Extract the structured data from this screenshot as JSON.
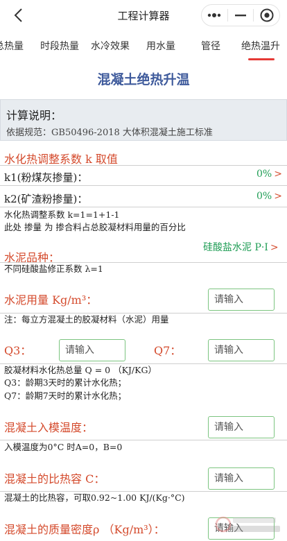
{
  "navbar": {
    "title": "工程计算器",
    "back_icon": "chevron-left-icon",
    "more_icon": "more-dots-icon",
    "minimize_icon": "minimize-icon",
    "close_icon": "target-circle-icon"
  },
  "tabs": [
    {
      "label": "总热量"
    },
    {
      "label": "时段热量"
    },
    {
      "label": "水冷效果"
    },
    {
      "label": "用水量"
    },
    {
      "label": "管径"
    },
    {
      "label": "绝热温升",
      "active": true
    }
  ],
  "page_title": "混凝土绝热升温",
  "explain": {
    "heading": "计算说明：",
    "reference": "依据规范：GB50496-2018 大体积混凝土施工标准"
  },
  "k_section": {
    "heading": "水化热调整系数 k 取值",
    "k1_label": "k1(粉煤灰掺量)：",
    "k1_value": "0%",
    "k2_label": "k2(矿渣粉掺量)：",
    "k2_value": "0%",
    "note1": "水化热调整系数 k=1=1+1-1",
    "note2": "此处 掺量 为 掺合料占总胶凝材料用量的百分比"
  },
  "cement_type": {
    "label": "水泥品种：",
    "value": "硅酸盐水泥 P·I",
    "note": "不同硅酸盐修正系数 λ=1"
  },
  "cement_amount": {
    "label": "水泥用量 Kg/m³：",
    "placeholder": "请输入",
    "note": "注：每立方混凝土的胶凝材料（水泥）用量"
  },
  "heat": {
    "q3_label": "Q3：",
    "q3_placeholder": "请输入",
    "q7_label": "Q7：",
    "q7_placeholder": "请输入",
    "note1": "胶凝材料水化热总量 Q = 0 （KJ/KG）",
    "note2": "Q3：龄期3天时的累计水化热；",
    "note3": "Q7：龄期7天时的累计水化热；"
  },
  "mold_temp": {
    "label": "混凝土入模温度：",
    "placeholder": "请输入",
    "note": "入模温度为0°C 时A=0，B=0"
  },
  "specific_heat": {
    "label": "混凝土的比热容 C：",
    "placeholder": "请输入",
    "note": "混凝土的比热容，可取0.92~1.00 KJ/(Kg·°C)"
  },
  "density": {
    "label": "混凝土的质量密度ρ （Kg/m³）：",
    "placeholder": "请输入"
  },
  "colors": {
    "accent_red": "#d44a2c",
    "title_blue": "#3f5b9c",
    "value_green": "#1f9d55",
    "input_border": "#7bc47f"
  }
}
